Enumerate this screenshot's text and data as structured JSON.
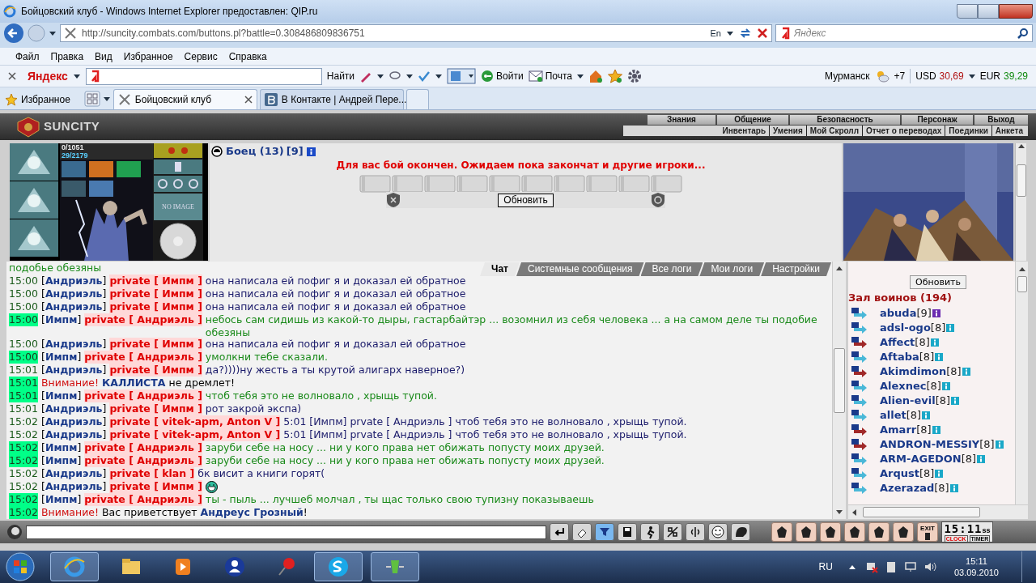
{
  "window": {
    "title": "Бойцовский клуб - Windows Internet Explorer предоставлен: QIP.ru"
  },
  "address_bar": {
    "url": "http://suncity.combats.com/buttons.pl?battle=0.308486809836751",
    "lang": "En",
    "search_placeholder": "Яндекс"
  },
  "menu": [
    "Файл",
    "Правка",
    "Вид",
    "Избранное",
    "Сервис",
    "Справка"
  ],
  "yandex_bar": {
    "logo": "Яндекс",
    "find": "Найти",
    "login": "Войти",
    "mail": "Почта",
    "city": "Мурманск",
    "temp": "+7",
    "usd_label": "USD",
    "usd": "30,69",
    "eur_label": "EUR",
    "eur": "39,29"
  },
  "favorites": "Избранное",
  "tabs": [
    {
      "label": "Бойцовский клуб",
      "selected": true
    },
    {
      "label": "В Контакте | Андрей Пере...",
      "selected": false
    }
  ],
  "game": {
    "logo": "SUNCITY",
    "nav_top": [
      "Знания",
      "Общение",
      "Безопасность",
      "Персонаж",
      "Выход"
    ],
    "nav_bottom": [
      "Инвентарь",
      "Умения",
      "Мой Скролл",
      "Отчет о переводах",
      "Поединки",
      "Анкета"
    ],
    "hp": "0/1051",
    "mana": "29/2179",
    "no_image": "NO IMAGE",
    "fighter": {
      "name": "Боец (13)",
      "align": "[9]"
    },
    "battle_message": "Для вас бой окончен. Ожидаем пока закончат и другие игроки...",
    "refresh": "Обновить"
  },
  "chat_tabs": [
    {
      "label": "Чат",
      "selected": true
    },
    {
      "label": "Системные сообщения",
      "selected": false
    },
    {
      "label": "Все логи",
      "selected": false
    },
    {
      "label": "Мои логи",
      "selected": false
    },
    {
      "label": "Настройки",
      "selected": false
    }
  ],
  "chat": [
    {
      "kind": "continuation",
      "text": "подобье обезяны"
    },
    {
      "kind": "out",
      "time": "15:00",
      "highlighted": false,
      "sender": "[**Андриэль**]",
      "private": "private [ Импм ]",
      "text": "она написала ей пофиг я и доказал ей обратное"
    },
    {
      "kind": "out",
      "time": "15:00",
      "highlighted": false,
      "sender": "[**Андриэль**]",
      "private": "private [ Импм ]",
      "text": "она написала ей пофиг я и доказал ей обратное"
    },
    {
      "kind": "out",
      "time": "15:00",
      "highlighted": false,
      "sender": "[**Андриэль**]",
      "private": "private [ Импм ]",
      "text": "она написала ей пофиг я и доказал ей обратное"
    },
    {
      "kind": "in",
      "time": "15:00",
      "highlighted": true,
      "sender": "[**Импм**]",
      "private": "private [ Андриэль ]",
      "text": "небось сам сидишь из какой-то дыры, гастарбайтэр ... возомнил из себя человека ... а на самом деле ты подобие обезяны"
    },
    {
      "kind": "out",
      "time": "15:00",
      "highlighted": false,
      "sender": "[**Андриэль**]",
      "private": "private [ Импм ]",
      "text": "она написала ей пофиг я и доказал ей обратное"
    },
    {
      "kind": "in",
      "time": "15:00",
      "highlighted": true,
      "sender": "[**Импм**]",
      "private": "private [ Андриэль ]",
      "text": "умолкни тебе сказали."
    },
    {
      "kind": "out",
      "time": "15:01",
      "highlighted": false,
      "sender": "[**Андриэль**]",
      "private": "private [ Импм ]",
      "text": "да?))))ну жесть а ты крутой алигарх наверное?)"
    },
    {
      "kind": "notice",
      "time": "15:01",
      "highlighted": true,
      "label": "Внимание!",
      "text": "**КАЛЛИСТА** не дремлет!"
    },
    {
      "kind": "in",
      "time": "15:01",
      "highlighted": true,
      "sender": "[**Импм**]",
      "private": "private [ Андриэль ]",
      "text": "чтоб тебя это не волновало , хрыщь тупой."
    },
    {
      "kind": "out",
      "time": "15:01",
      "highlighted": false,
      "sender": "[**Андриэль**]",
      "private": "private [ Импм ]",
      "text": "рот закрой экспа)"
    },
    {
      "kind": "out",
      "time": "15:02",
      "highlighted": false,
      "sender": "[**Андриэль**]",
      "private": "private [ vitek-apm, Anton V ]",
      "text": "5:01 [Импм] prvate [ Андриэль ] чтоб тебя это не волновало , хрыщь тупой."
    },
    {
      "kind": "out",
      "time": "15:02",
      "highlighted": false,
      "sender": "[**Андриэль**]",
      "private": "private [ vitek-apm, Anton V ]",
      "text": "5:01 [Импм] prvate [ Андриэль ] чтоб тебя это не волновало , хрыщь тупой."
    },
    {
      "kind": "in",
      "time": "15:02",
      "highlighted": true,
      "sender": "[**Импм**]",
      "private": "private [ Андриэль ]",
      "text": "заруби себе на носу ... ни у кого права нет обижать попусту моих друзей."
    },
    {
      "kind": "in",
      "time": "15:02",
      "highlighted": true,
      "sender": "[**Импм**]",
      "private": "private [ Андриэль ]",
      "text": "заруби себе на носу ... ни у кого права нет обижать попусту моих друзей."
    },
    {
      "kind": "out",
      "time": "15:02",
      "highlighted": false,
      "sender": "[**Андриэль**]",
      "private": "private [ klan ]",
      "text": "бк висит а книги горят("
    },
    {
      "kind": "out",
      "time": "15:02",
      "highlighted": false,
      "sender": "[**Андриэль**]",
      "private": "private [ Импм ]",
      "emoticon": true
    },
    {
      "kind": "in",
      "time": "15:02",
      "highlighted": true,
      "sender": "[**Импм**]",
      "private": "private [ Андриэль ]",
      "text": "ты - пыль ... лучшеб молчал , ты щас только свою тупизну показываешь"
    },
    {
      "kind": "notice",
      "time": "15:02",
      "highlighted": true,
      "label": "Внимание!",
      "text": "Вас приветствует **Андреус Грозный**!"
    }
  ],
  "online": {
    "refresh": "Обновить",
    "title": "Зал воинов (194)",
    "users": [
      {
        "name": "abuda",
        "level": "[9]",
        "color": "#4ab8d8",
        "info": {
          "color": "#6a2ab0"
        }
      },
      {
        "name": "adsl-ogo",
        "level": "[8]",
        "color": "#4ab8d8",
        "info": {
          "color": "#1aa8c8"
        }
      },
      {
        "name": "Affect",
        "level": "[8]",
        "color": "#a02828",
        "info": {
          "color": "#1aa8c8"
        }
      },
      {
        "name": "Aftaba",
        "level": "[8]",
        "color": "#4ab8d8",
        "info": {
          "color": "#1aa8c8"
        }
      },
      {
        "name": "Akimdimon",
        "level": "[8]",
        "color": "#a02828",
        "info": {
          "color": "#1aa8c8"
        }
      },
      {
        "name": "Alexnec",
        "level": "[8]",
        "color": "#4ab8d8",
        "info": {
          "color": "#1aa8c8"
        }
      },
      {
        "name": "Alien-evil",
        "level": "[8]",
        "color": "#4ab8d8",
        "info": {
          "color": "#1aa8c8"
        }
      },
      {
        "name": "allet",
        "level": "[8]",
        "color": "#4ab8d8",
        "info": {
          "color": "#1aa8c8"
        }
      },
      {
        "name": "Amarr",
        "level": "[8]",
        "color": "#a02828",
        "info": {
          "color": "#1aa8c8"
        }
      },
      {
        "name": "ANDRON-MESSIY",
        "level": "[8]",
        "color": "#a02828",
        "info": {
          "color": "#1aa8c8"
        }
      },
      {
        "name": "ARM-AGEDON",
        "level": "[8]",
        "color": "#4ab8d8",
        "info": {
          "color": "#1aa8c8"
        }
      },
      {
        "name": "Arqust",
        "level": "[8]",
        "color": "#4ab8d8",
        "info": {
          "color": "#1aa8c8"
        }
      },
      {
        "name": "Azerazad",
        "level": "[8]",
        "color": "#4ab8d8",
        "info": {
          "color": "#1aa8c8"
        }
      }
    ]
  },
  "bottom_bar": {
    "exit": "EXIT",
    "clock_time": "15:11",
    "clock_suffix": "ss",
    "clock": "CLOCK",
    "timer": "TIMER"
  },
  "taskbar": {
    "lang": "RU",
    "time": "15:11",
    "date": "03.09.2010"
  }
}
